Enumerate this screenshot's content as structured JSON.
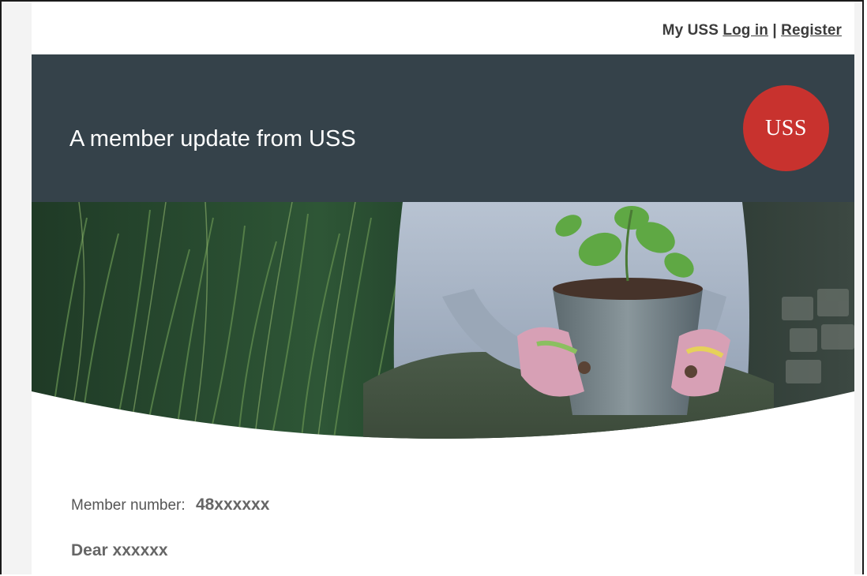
{
  "top_links": {
    "prefix": "My USS",
    "login_label": "Log in",
    "separator": "|",
    "register_label": "Register"
  },
  "header": {
    "title": "A member update from USS",
    "logo_text": "USS"
  },
  "hero": {
    "icon": "hero-photo-gardener-holding-potted-plant"
  },
  "member": {
    "label": "Member number:",
    "number": "48xxxxxx"
  },
  "greeting": "Dear xxxxxx",
  "colors": {
    "header_bg": "#35424a",
    "logo_red": "#c8322e",
    "page_bg": "#f3f3f3"
  }
}
